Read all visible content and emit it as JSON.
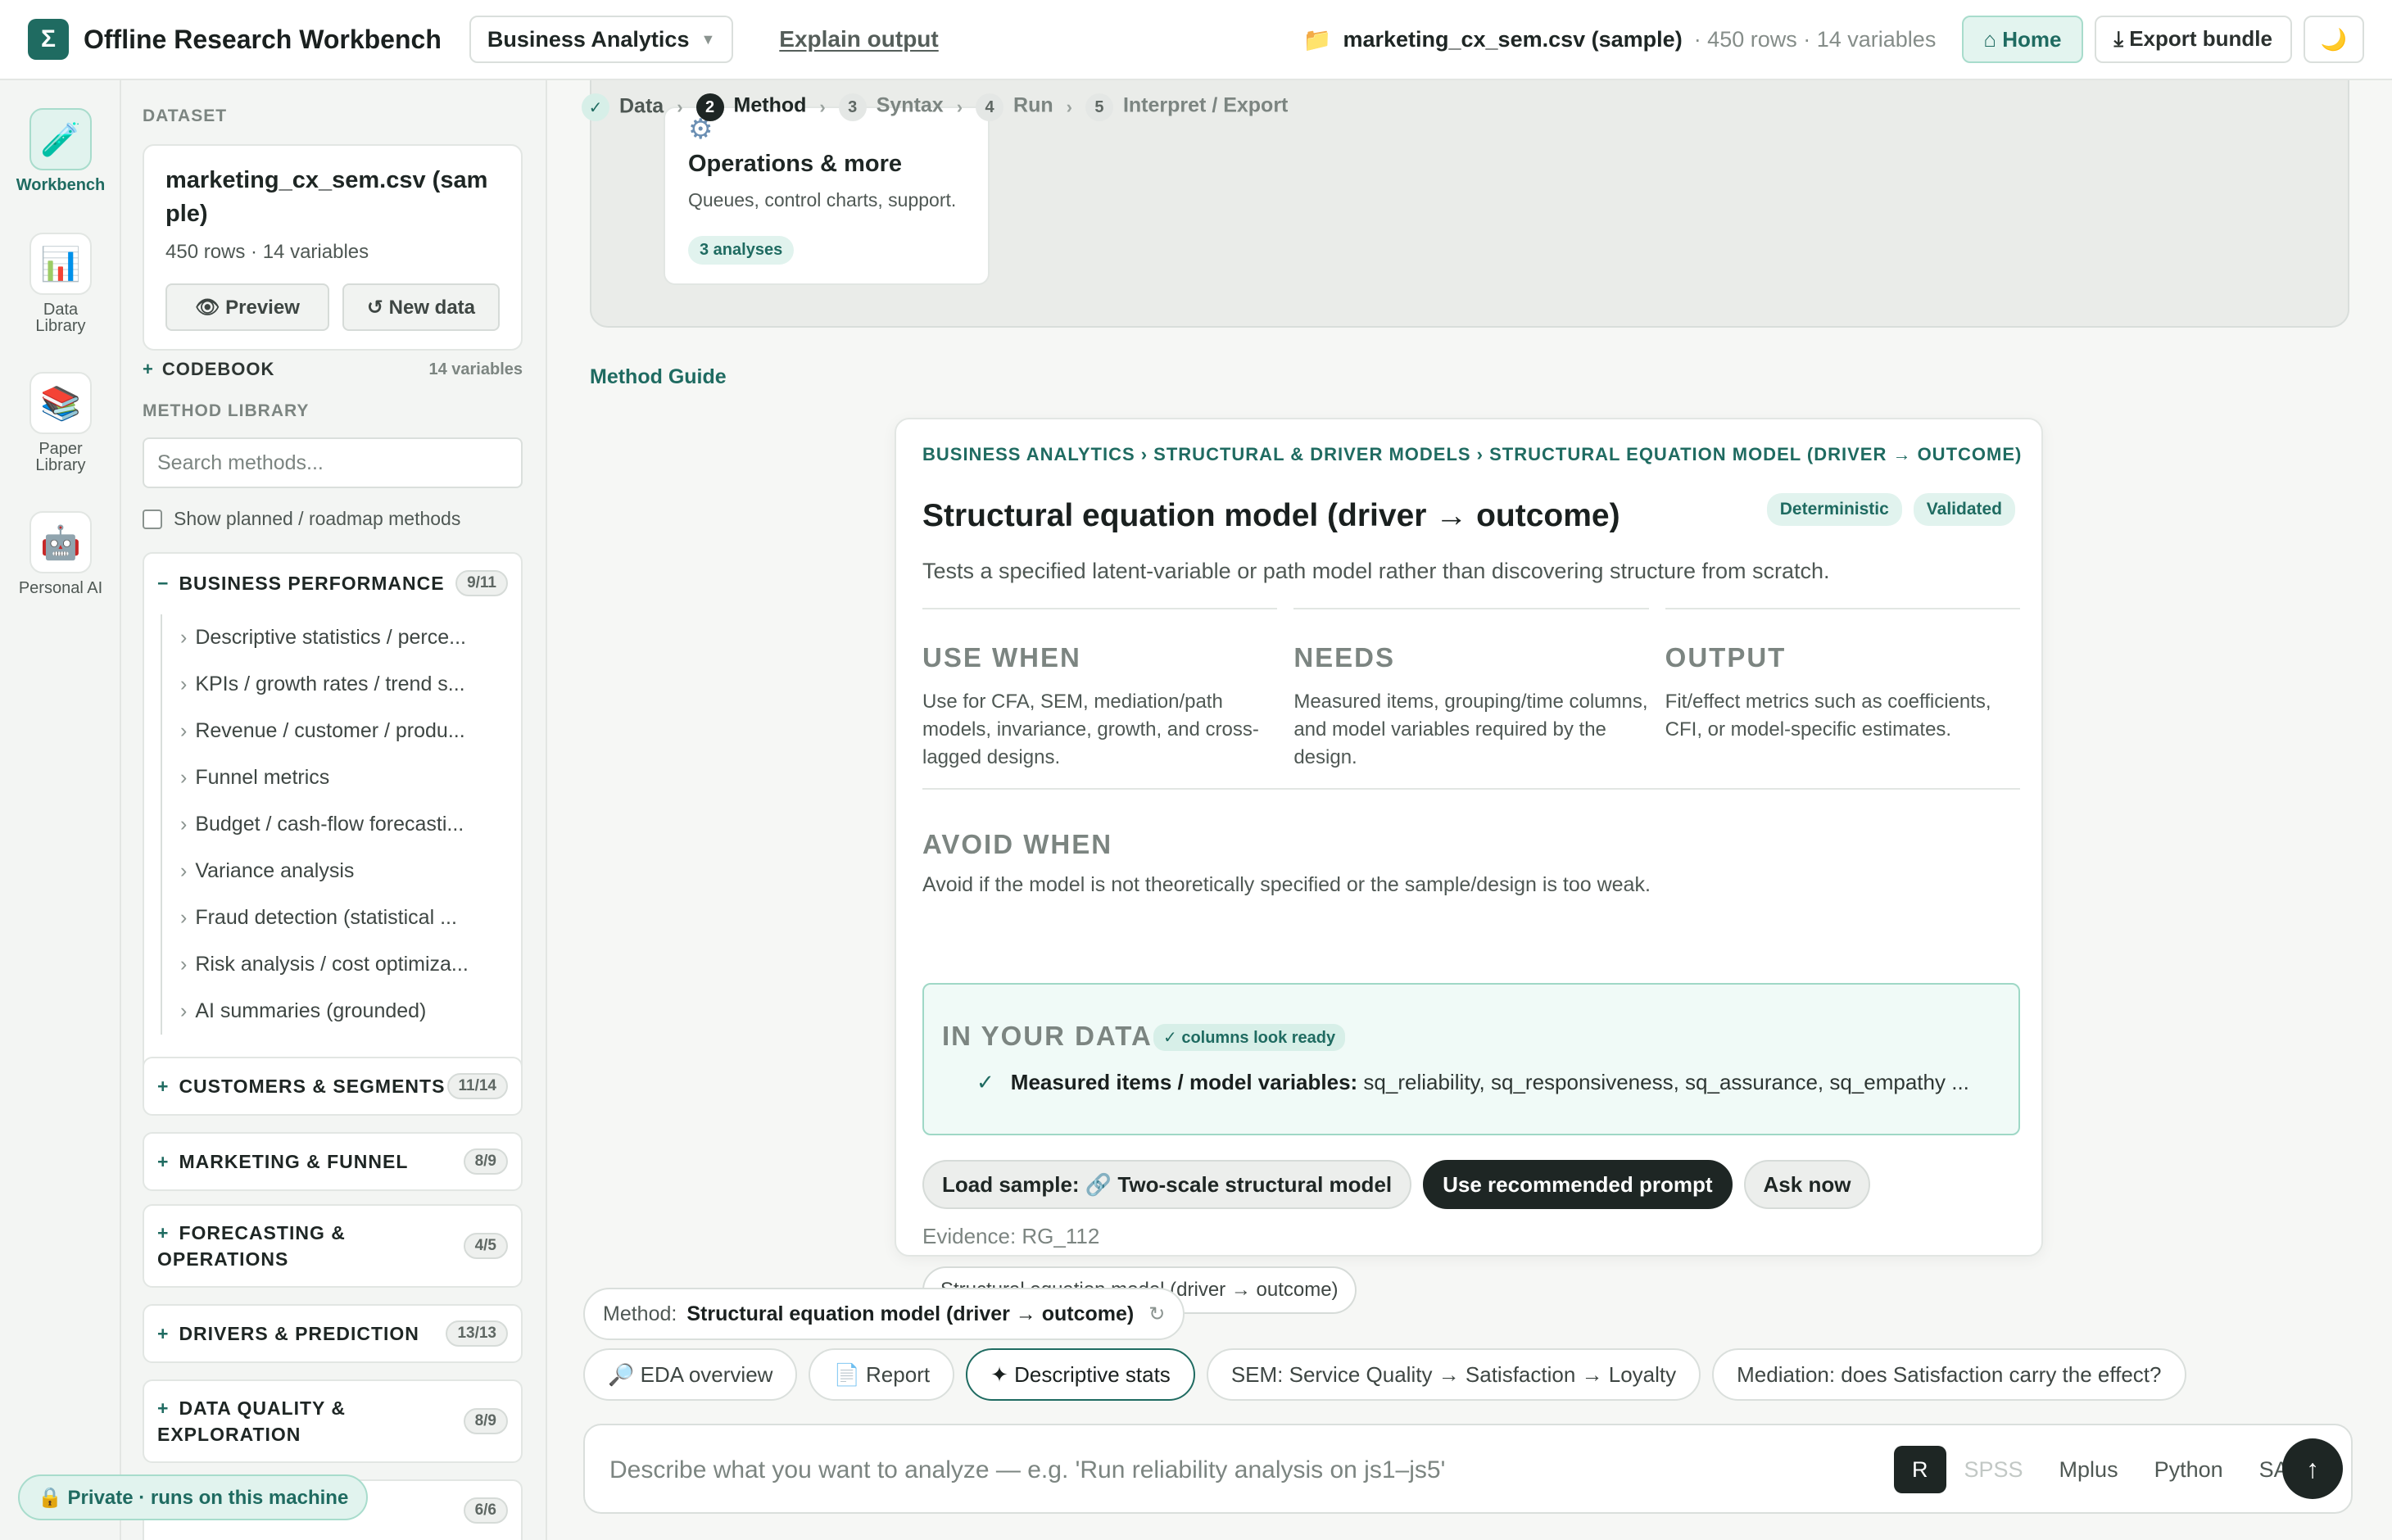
{
  "app": {
    "title": "Offline Research Workbench",
    "logo_glyph": "Σ",
    "domain": "Business Analytics",
    "explain": "Explain output"
  },
  "file": {
    "name": "marketing_cx_sem.csv (sample)",
    "meta": "· 450 rows · 14 variables"
  },
  "top_actions": {
    "home": "⌂ Home",
    "export": "⤓ Export bundle",
    "theme_icon": "moon-icon"
  },
  "rail": [
    {
      "label": "Workbench",
      "icon": "🧪"
    },
    {
      "label": "Data Library",
      "icon": "📊"
    },
    {
      "label": "Paper Library",
      "icon": "📚"
    },
    {
      "label": "Personal AI",
      "icon": "🤖"
    }
  ],
  "dataset": {
    "caption": "DATASET",
    "name": "marketing_cx_sem.csv (sample)",
    "meta": "450 rows · 14 variables",
    "preview": "👁 Preview",
    "new_data": "↺ New data"
  },
  "codebook": {
    "label": "CODEBOOK",
    "count": "14 variables"
  },
  "library": {
    "caption": "METHOD LIBRARY",
    "search_placeholder": "Search methods...",
    "show_planned": "Show planned / roadmap methods",
    "groups": [
      {
        "title": "BUSINESS PERFORMANCE",
        "count": "9/11",
        "expanded": true,
        "items": [
          "Descriptive statistics / perce...",
          "KPIs / growth rates / trend s...",
          "Revenue / customer / produ...",
          "Funnel metrics",
          "Budget / cash-flow forecasti...",
          "Variance analysis",
          "Fraud detection (statistical ...",
          "Risk analysis / cost optimiza...",
          "AI summaries (grounded)"
        ]
      },
      {
        "title": "CUSTOMERS & SEGMENTS",
        "count": "11/14"
      },
      {
        "title": "MARKETING & FUNNEL",
        "count": "8/9"
      },
      {
        "title": "FORECASTING & OPERATIONS",
        "count": "4/5"
      },
      {
        "title": "DRIVERS & PREDICTION",
        "count": "13/13"
      },
      {
        "title": "DATA QUALITY & EXPLORATION",
        "count": "8/9"
      },
      {
        "title": "",
        "count": "6/6"
      }
    ]
  },
  "private_badge": "🔒 Private · runs on this machine",
  "steps": [
    {
      "num": "✓",
      "label": "Data",
      "state": "done"
    },
    {
      "num": "2",
      "label": "Method",
      "state": "current"
    },
    {
      "num": "3",
      "label": "Syntax",
      "state": "future"
    },
    {
      "num": "4",
      "label": "Run",
      "state": "future"
    },
    {
      "num": "5",
      "label": "Interpret / Export",
      "state": "future"
    }
  ],
  "ops_card": {
    "title": "Operations & more",
    "desc": "Queues, control charts, support.",
    "count": "3 analyses"
  },
  "method_guide_link": "Method Guide",
  "guide": {
    "breadcrumb": "BUSINESS ANALYTICS › STRUCTURAL & DRIVER MODELS › STRUCTURAL EQUATION MODEL (DRIVER → OUTCOME)",
    "title": "Structural equation model (driver → outcome)",
    "badges": [
      "Deterministic",
      "Validated"
    ],
    "desc": "Tests a specified latent-variable or path model rather than discovering structure from scratch.",
    "use_when": {
      "h": "USE WHEN",
      "p": "Use for CFA, SEM, mediation/path models, invariance, growth, and cross-lagged designs."
    },
    "needs": {
      "h": "NEEDS",
      "p": "Measured items, grouping/time columns, and model variables required by the design."
    },
    "output": {
      "h": "OUTPUT",
      "p": "Fit/effect metrics such as coefficients, CFI, or model-specific estimates."
    },
    "avoid_h": "AVOID WHEN",
    "avoid_p": "Avoid if the model is not theoretically specified or the sample/design is too weak.",
    "in_data": {
      "h": "IN YOUR DATA",
      "ready": "✓ columns look ready",
      "row_label": "Measured items / model variables:",
      "row_value": "sq_reliability, sq_responsiveness, sq_assurance, sq_empathy ..."
    },
    "load_sample": "Load sample: 🔗 Two-scale structural model",
    "use_prompt": "Use recommended prompt",
    "ask_now": "Ask now",
    "evidence": "Evidence: RG_112",
    "tag": "Structural equation model (driver → outcome)"
  },
  "method_chip": {
    "label": "Method:",
    "value": "Structural equation model (driver → outcome)"
  },
  "suggestions": [
    "🔎 EDA overview",
    "📄 Report",
    "✦ Descriptive stats",
    "SEM: Service Quality → Satisfaction → Loyalty",
    "Mediation: does Satisfaction carry the effect?"
  ],
  "prompt": {
    "placeholder": "Describe what you want to analyze — e.g. 'Run reliability analysis on js1–js5'",
    "languages": [
      "R",
      "SPSS",
      "Mplus",
      "Python",
      "SAS"
    ],
    "selected_language": "R",
    "send_icon": "↑"
  }
}
